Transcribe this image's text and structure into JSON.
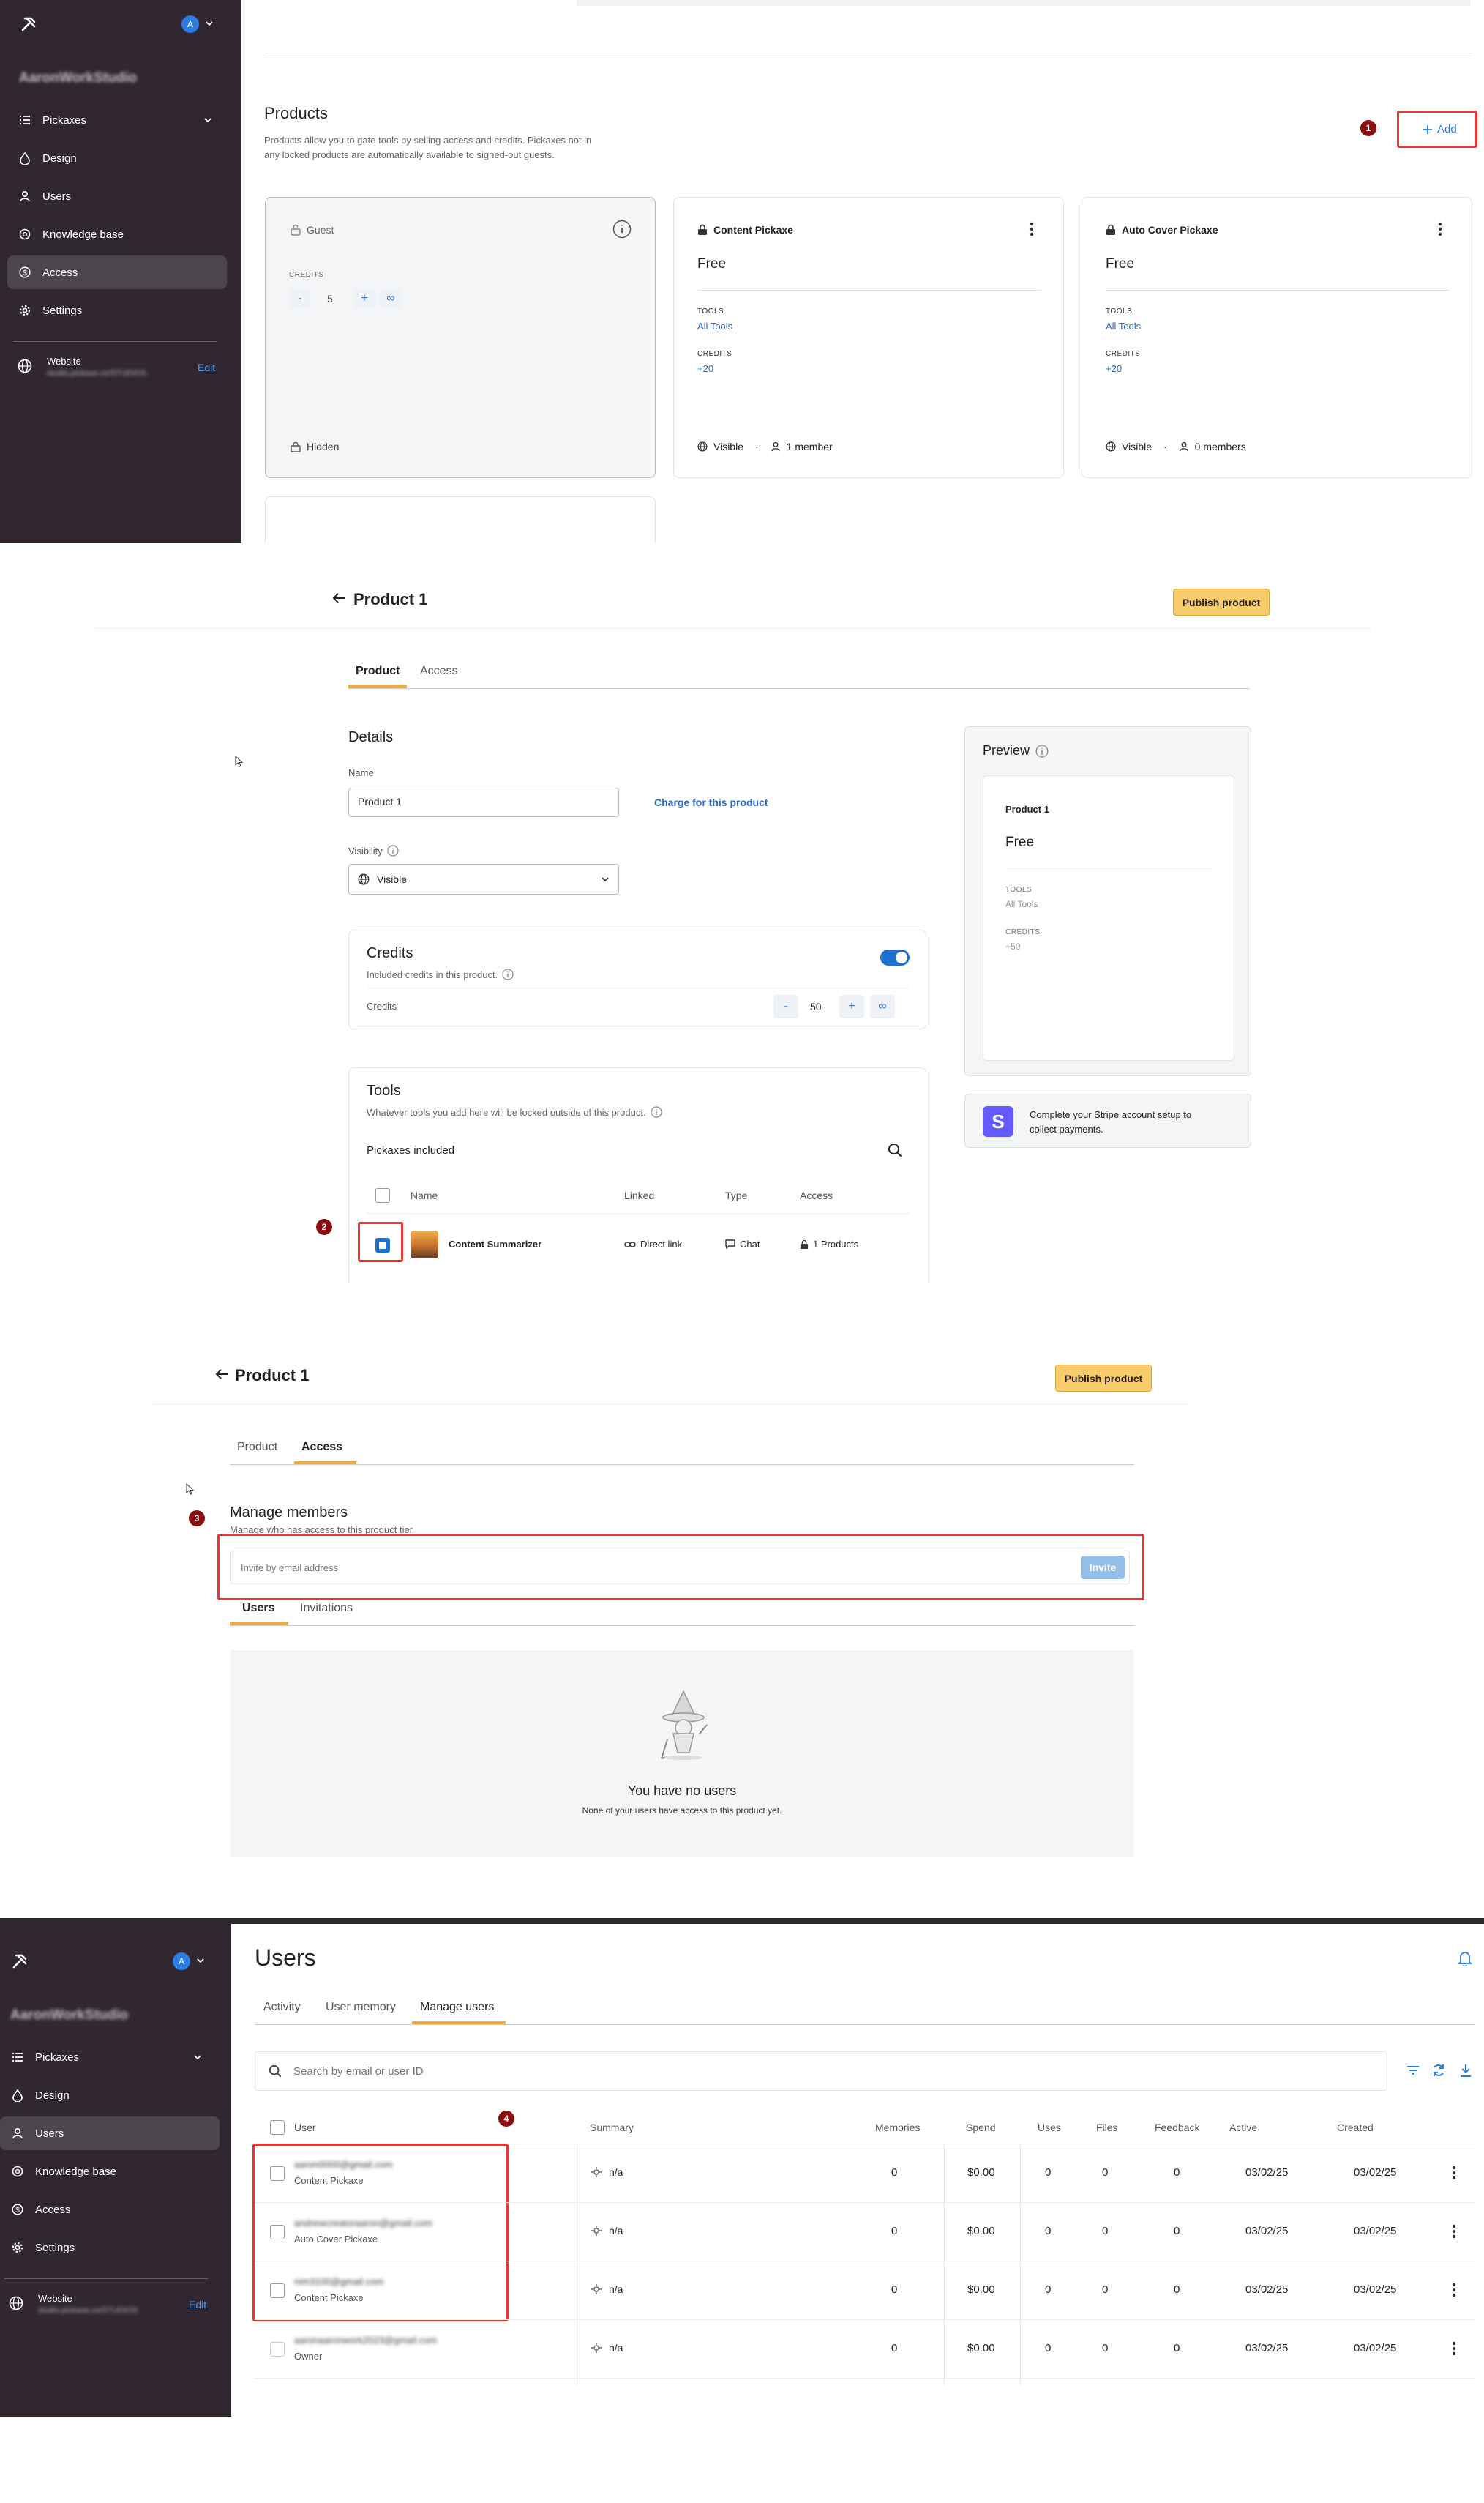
{
  "sidebar": {
    "workspace": "AaronWorkStudio",
    "avatar_letter": "A",
    "items": [
      {
        "label": "Pickaxes",
        "icon": "list-icon"
      },
      {
        "label": "Design",
        "icon": "droplet-icon"
      },
      {
        "label": "Users",
        "icon": "user-icon"
      },
      {
        "label": "Knowledge base",
        "icon": "brain-icon"
      },
      {
        "label": "Access",
        "icon": "dollar-icon"
      },
      {
        "label": "Settings",
        "icon": "gear-icon"
      }
    ],
    "website_label": "Website",
    "website_url": "studio.pickaxe.co/STUDIOS",
    "edit_label": "Edit"
  },
  "products_page": {
    "title": "Products",
    "description_1": "Products allow you to gate tools by selling access and credits. Pickaxes not in",
    "description_2": "any locked products are automatically available to signed-out guests.",
    "badge": "1",
    "add_label": "Add",
    "guest_card": {
      "title": "Guest",
      "credits_label": "CREDITS",
      "minus": "-",
      "value": "5",
      "plus": "+",
      "infinity": "∞",
      "status": "Hidden"
    },
    "product_cards": [
      {
        "title": "Content Pickaxe",
        "price": "Free",
        "tools_label": "TOOLS",
        "tools": "All Tools",
        "credits_label": "CREDITS",
        "credits": "+20",
        "visibility": "Visible",
        "members": "1 member"
      },
      {
        "title": "Auto Cover Pickaxe",
        "price": "Free",
        "tools_label": "TOOLS",
        "tools": "All Tools",
        "credits_label": "CREDITS",
        "credits": "+20",
        "visibility": "Visible",
        "members": "0 members"
      }
    ]
  },
  "product_editor": {
    "title": "Product 1",
    "publish_label": "Publish product",
    "tabs": [
      "Product",
      "Access"
    ],
    "details_heading": "Details",
    "name_label": "Name",
    "name_value": "Product 1",
    "charge_link": "Charge for this product",
    "visibility_label": "Visibility",
    "visibility_value": "Visible",
    "credits": {
      "heading": "Credits",
      "subtitle": "Included credits in this product.",
      "row_label": "Credits",
      "minus": "-",
      "value": "50",
      "plus": "+",
      "infinity": "∞",
      "toggle_on": true
    },
    "tools": {
      "heading": "Tools",
      "subtitle": "Whatever tools you add here will be locked outside of this product.",
      "included_label": "Pickaxes included",
      "columns": [
        "Name",
        "Linked",
        "Type",
        "Access"
      ],
      "rows": [
        {
          "name": "Content Summarizer",
          "linked": "Direct link",
          "type": "Chat",
          "access": "1 Products",
          "checked": true
        }
      ]
    },
    "badge": "2",
    "preview": {
      "heading": "Preview",
      "title": "Product 1",
      "price": "Free",
      "tools_label": "TOOLS",
      "tools": "All Tools",
      "credits_label": "CREDITS",
      "credits": "+50"
    },
    "stripe": {
      "logo": "S",
      "text_1": "Complete your Stripe account ",
      "link": "setup",
      "text_2": " to",
      "text_3": "collect payments."
    }
  },
  "access_editor": {
    "title": "Product 1",
    "publish_label": "Publish product",
    "tabs": [
      "Product",
      "Access"
    ],
    "badge": "3",
    "manage_heading": "Manage members",
    "manage_subtitle": "Manage who has access to this product tier",
    "invite_placeholder": "Invite by email address",
    "invite_label": "Invite",
    "subtabs": [
      "Users",
      "Invitations"
    ],
    "empty_title": "You have no users",
    "empty_subtitle": "None of your users have access to this product yet."
  },
  "users_page": {
    "title": "Users",
    "tabs": [
      "Activity",
      "User memory",
      "Manage users"
    ],
    "search_placeholder": "Search by email or user ID",
    "badge": "4",
    "columns": [
      "User",
      "Summary",
      "Memories",
      "Spend",
      "Uses",
      "Files",
      "Feedback",
      "Active",
      "Created"
    ],
    "rows": [
      {
        "email": "aaron0000@gmail.com",
        "product": "Content Pickaxe",
        "summary": "n/a",
        "memories": "0",
        "spend": "$0.00",
        "uses": "0",
        "files": "0",
        "feedback": "0",
        "active": "03/02/25",
        "created": "03/02/25"
      },
      {
        "email": "andrewcreatoraaron@gmail.com",
        "product": "Auto Cover Pickaxe",
        "summary": "n/a",
        "memories": "0",
        "spend": "$0.00",
        "uses": "0",
        "files": "0",
        "feedback": "0",
        "active": "03/02/25",
        "created": "03/02/25"
      },
      {
        "email": "nim3100@gmail.com",
        "product": "Content Pickaxe",
        "summary": "n/a",
        "memories": "0",
        "spend": "$0.00",
        "uses": "0",
        "files": "0",
        "feedback": "0",
        "active": "03/02/25",
        "created": "03/02/25"
      },
      {
        "email": "aaronaaronwork2023@gmail.com",
        "product": "Owner",
        "summary": "n/a",
        "memories": "0",
        "spend": "$0.00",
        "uses": "0",
        "files": "0",
        "feedback": "0",
        "active": "03/02/25",
        "created": "03/02/25"
      }
    ]
  },
  "colors": {
    "sidebar": "#302730",
    "accent": "#2a7de1",
    "publish": "#f9cc6b",
    "annotation": "#e33333",
    "badge": "#8b0f10",
    "tab_underline": "#f1a93a"
  }
}
